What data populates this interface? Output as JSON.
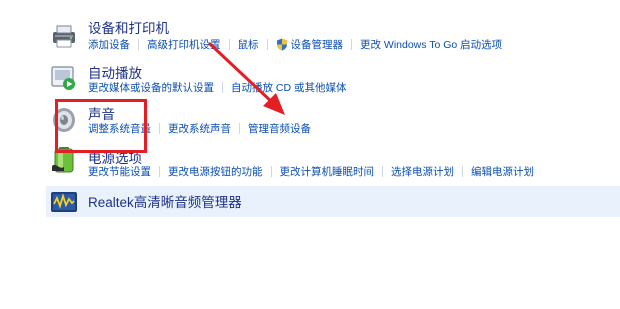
{
  "categories": [
    {
      "title": "设备和打印机",
      "icon": "printer-icon",
      "links": [
        "添加设备",
        "高级打印机设置",
        "鼠标",
        "设备管理器",
        "更改 Windows To Go 启动选项"
      ]
    },
    {
      "title": "自动播放",
      "icon": "autoplay-icon",
      "links": [
        "更改媒体或设备的默认设置",
        "自动播放 CD 或其他媒体"
      ]
    },
    {
      "title": "声音",
      "icon": "speaker-icon",
      "links": [
        "调整系统音量",
        "更改系统声音",
        "管理音频设备"
      ]
    },
    {
      "title": "电源选项",
      "icon": "battery-icon",
      "links": [
        "更改节能设置",
        "更改电源按钮的功能",
        "更改计算机睡眠时间",
        "选择电源计划",
        "编辑电源计划"
      ]
    },
    {
      "title": "Realtek高清晰音频管理器",
      "icon": "realtek-audio-icon",
      "links": []
    }
  ],
  "annotation": {
    "highlight_color": "#e51d24",
    "shield_icon": "uac-shield-icon"
  }
}
